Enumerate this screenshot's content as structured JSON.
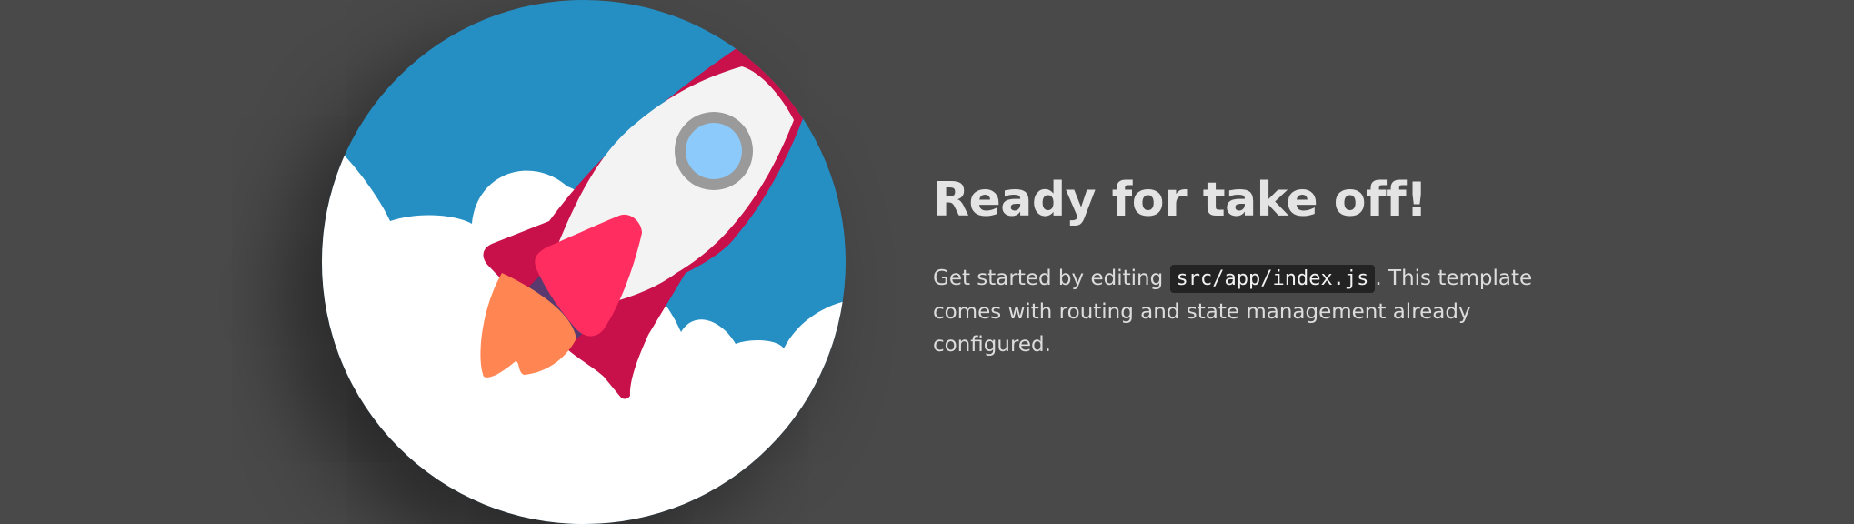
{
  "hero": {
    "headline": "Ready for take off!",
    "description_before": "Get started by editing ",
    "code_path": "src/app/index.js",
    "description_after": ". This template comes with routing and state management already configured."
  },
  "illustration": {
    "icon": "rocket-icon",
    "colors": {
      "sky": "#258fc4",
      "clouds": "#ffffff",
      "rocket_body": "#f3f3f3",
      "rocket_outline": "#c8104a",
      "fin": "#ff2d60",
      "nozzle": "#5a3a6e",
      "flame": "#ff8552",
      "window_ring": "#9a9a9a",
      "window_glass": "#8ccafb"
    }
  },
  "theme": {
    "background": "#494949",
    "headline_color": "#e4e4e4",
    "text_color": "#dcdcdc",
    "code_background": "#232323"
  }
}
